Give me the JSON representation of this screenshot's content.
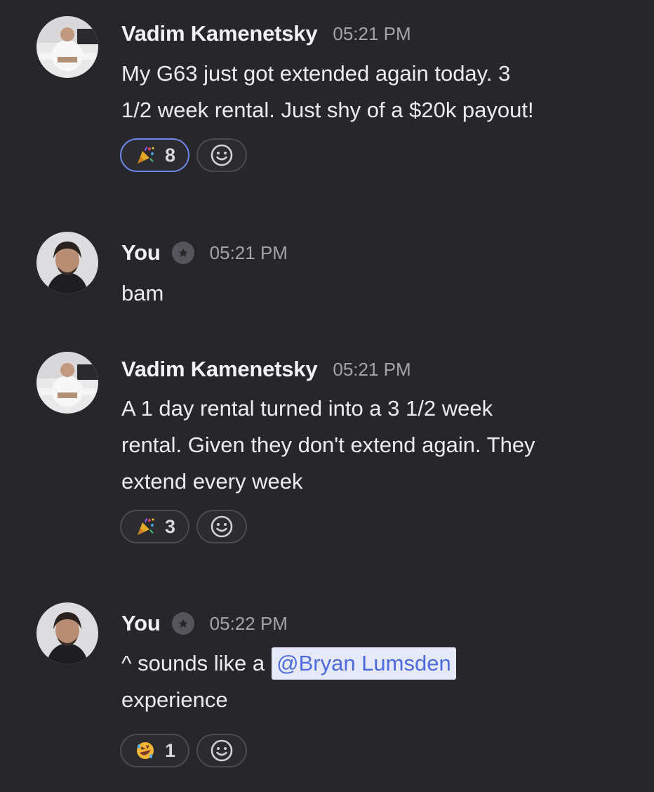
{
  "messages": [
    {
      "author": "Vadim Kamenetsky",
      "time": "05:21 PM",
      "lines": [
        "My G63 just got extended again today. 3",
        "1/2 week rental. Just shy of a $20k payout!"
      ],
      "reaction": {
        "emoji": "party-popper",
        "count": "8",
        "active": true
      }
    },
    {
      "author": "You",
      "time": "05:21 PM",
      "lines": [
        "bam"
      ]
    },
    {
      "author": "Vadim Kamenetsky",
      "time": "05:21 PM",
      "lines": [
        "A 1 day rental turned into a 3 1/2 week",
        "rental. Given they don't extend again. They",
        "extend every week"
      ],
      "reaction": {
        "emoji": "party-popper",
        "count": "3",
        "active": false
      }
    },
    {
      "author": "You",
      "time": "05:22 PM",
      "text_before_mention": "^ sounds like a",
      "mention": "@Bryan Lumsden",
      "text_after_mention": "experience",
      "reaction": {
        "emoji": "rolling-on-floor-laughing",
        "count": "1",
        "active": false
      }
    }
  ],
  "icons": {
    "badge": "star-badge-icon",
    "add_reaction": "smiley-icon"
  },
  "colors": {
    "background": "#27272b",
    "mention_bg": "#e5e9fb",
    "mention_text": "#4d6bdc",
    "active_reaction_border": "#6e86e6"
  }
}
